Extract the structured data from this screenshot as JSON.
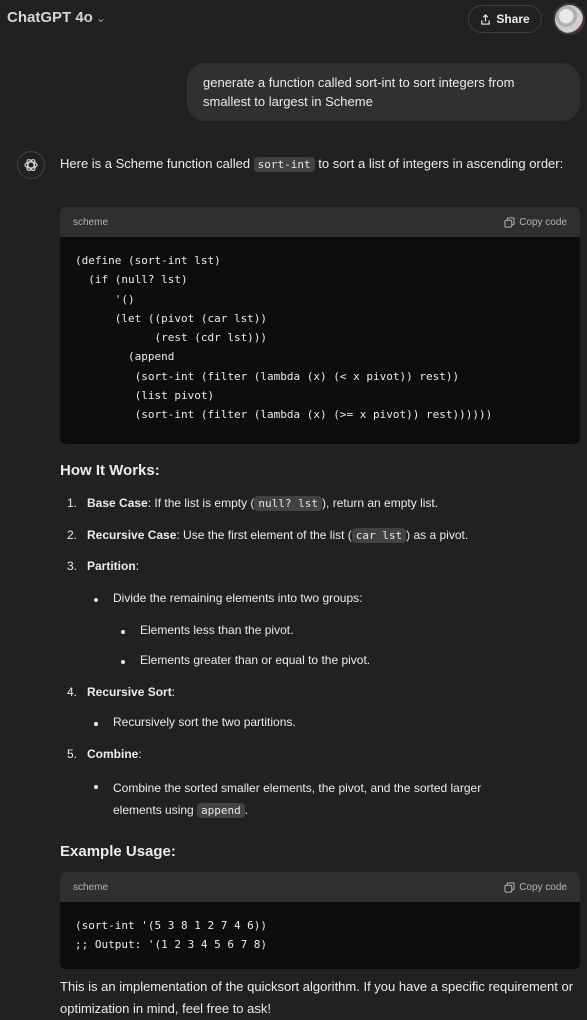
{
  "header": {
    "model": "ChatGPT 4o",
    "model_chevron": "⌄",
    "share_label": "Share"
  },
  "user_message": "generate a function called sort-int to sort integers from smallest to largest in Scheme",
  "assistant": {
    "intro_before": "Here is a Scheme function called ",
    "intro_code": "sort-int",
    "intro_after": " to sort a list of integers in ascending order:",
    "code1": {
      "language": "scheme",
      "copy_label": "Copy code",
      "code": "(define (sort-int lst)\n  (if (null? lst)\n      '()\n      (let ((pivot (car lst))\n            (rest (cdr lst)))\n        (append\n         (sort-int (filter (lambda (x) (< x pivot)) rest))\n         (list pivot)\n         (sort-int (filter (lambda (x) (>= x pivot)) rest))))))"
    },
    "how_heading": "How It Works:",
    "steps": [
      {
        "num": "1.",
        "bold": "Base Case",
        "text_before": ": If the list is empty (",
        "code": "null? lst",
        "text_after": "), return an empty list."
      },
      {
        "num": "2.",
        "bold": "Recursive Case",
        "text_before": ": Use the first element of the list (",
        "code": "car lst",
        "text_after": ") as a pivot."
      },
      {
        "num": "3.",
        "bold": "Partition",
        "text_after": ":"
      },
      {
        "num": "4.",
        "bold": "Recursive Sort",
        "text_after": ":"
      },
      {
        "num": "5.",
        "bold": "Combine",
        "text_after": ":"
      }
    ],
    "partition_bullet": "Divide the remaining elements into two groups:",
    "partition_sub1": "Elements less than the pivot.",
    "partition_sub2": "Elements greater than or equal to the pivot.",
    "recursive_bullet": "Recursively sort the two partitions.",
    "combine_bullet_line1": "Combine the sorted smaller elements, the pivot, and the sorted larger",
    "combine_bullet_line2": "elements using ",
    "combine_code": "append",
    "combine_end": ".",
    "example_heading": "Example Usage:",
    "code2": {
      "language": "scheme",
      "copy_label": "Copy code",
      "code": "(sort-int '(5 3 8 1 2 7 4 6))\n;; Output: '(1 2 3 4 5 6 7 8)"
    },
    "closing": "This is an implementation of the quicksort algorithm. If you have a specific requirement or optimization in mind, feel free to ask!"
  }
}
